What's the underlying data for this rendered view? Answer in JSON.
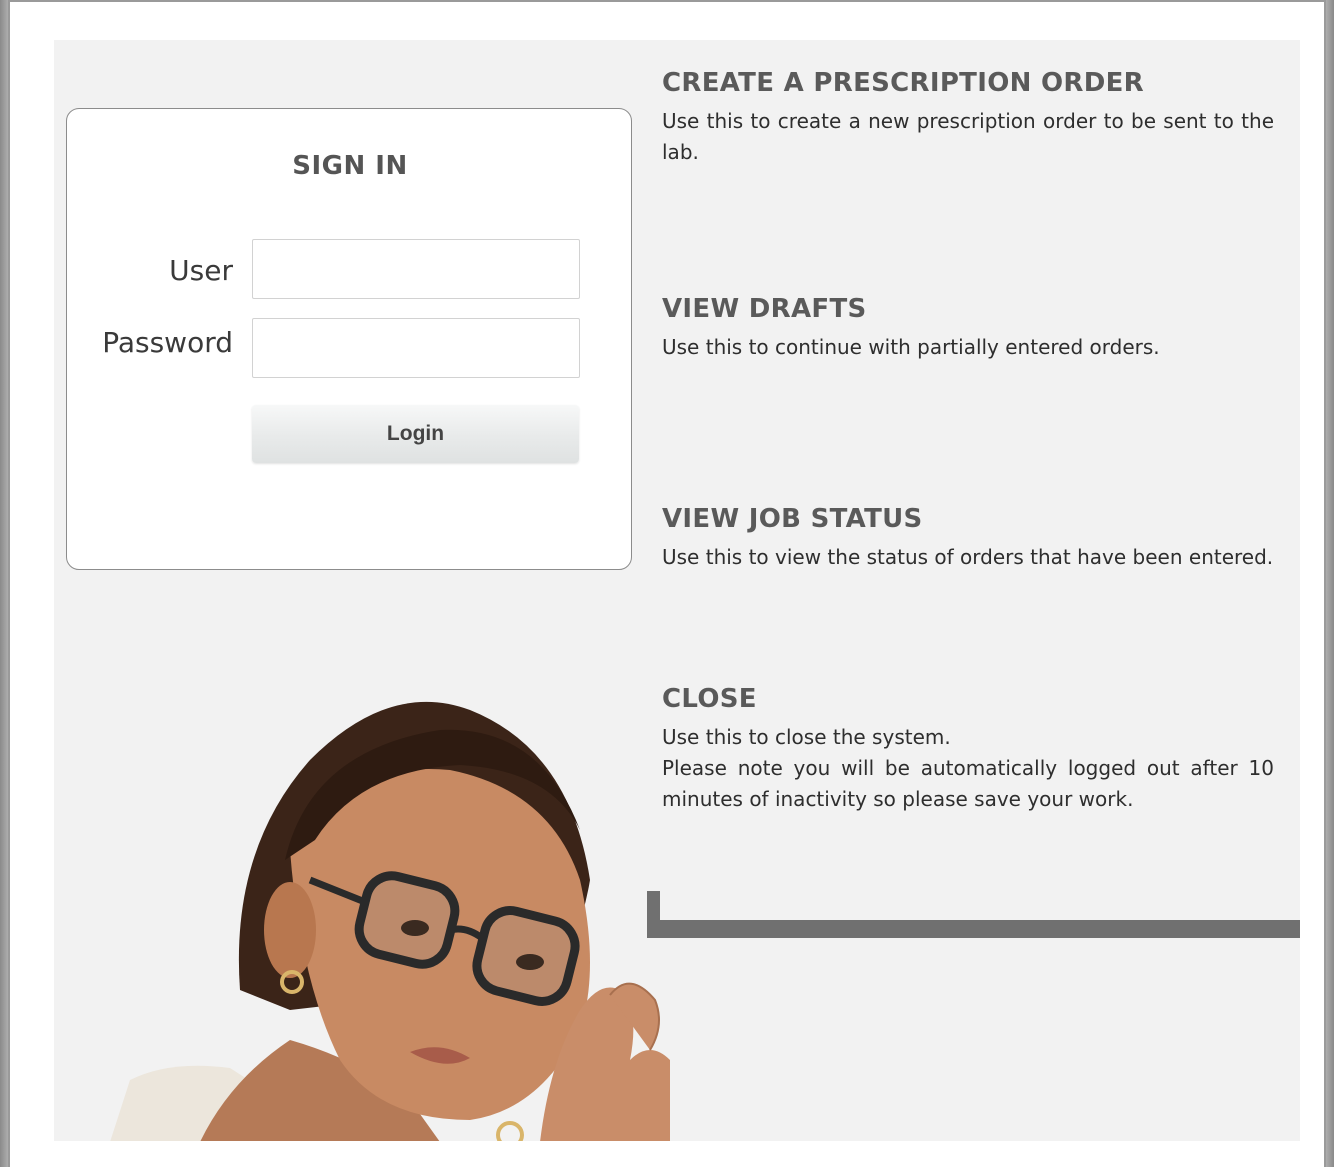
{
  "signin": {
    "title": "SIGN IN",
    "user_label": "User",
    "password_label": "Password",
    "user_value": "",
    "password_value": "",
    "login_label": "Login"
  },
  "sections": [
    {
      "title": "CREATE A PRESCRIPTION ORDER",
      "text": "Use this to create a new prescription order to be sent to the lab."
    },
    {
      "title": "VIEW DRAFTS",
      "text": "Use this to continue with partially entered orders."
    },
    {
      "title": "VIEW JOB STATUS",
      "text": "Use this to view the status of orders that have been entered."
    },
    {
      "title": "CLOSE",
      "text": "Use this to close the system.",
      "note": "Please note you will be automatically logged out after 10 minutes of inactivity so please save your work."
    }
  ],
  "colors": {
    "panel_bg": "#f2f2f2",
    "heading": "#5a5a5a",
    "divider": "#707070"
  }
}
